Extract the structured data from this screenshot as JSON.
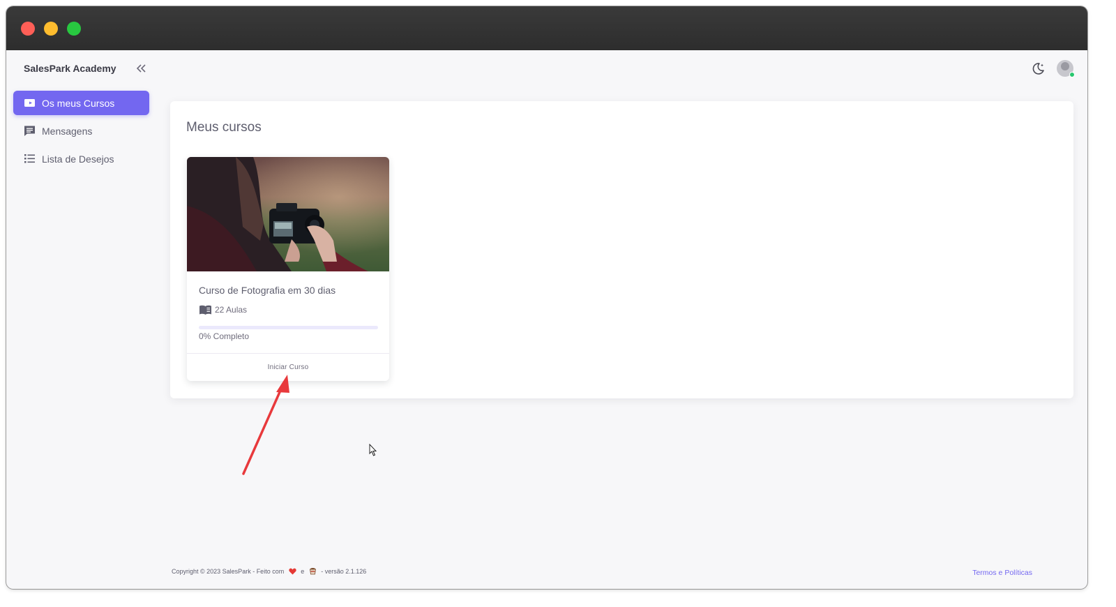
{
  "app": {
    "brand": "SalesPark Academy"
  },
  "sidebar": {
    "items": [
      {
        "label": "Os meus Cursos",
        "icon": "video-icon",
        "active": true
      },
      {
        "label": "Mensagens",
        "icon": "message-icon",
        "active": false
      },
      {
        "label": "Lista de Desejos",
        "icon": "list-icon",
        "active": false
      }
    ]
  },
  "header": {
    "theme_icon": "moon-icon",
    "avatar_status": "online"
  },
  "main": {
    "title": "Meus cursos",
    "courses": [
      {
        "title": "Curso de Fotografia em 30 dias",
        "lessons": "22 Aulas",
        "progress_percent": 0,
        "progress_text": "0% Completo",
        "action": "Iniciar Curso",
        "image": "photographer-with-camera"
      }
    ]
  },
  "footer": {
    "copyright_prefix": "Copyright © 2023 SalesPark - Feito com ",
    "copyright_and": " e ",
    "copyright_suffix": " - versão 2.1.126",
    "link": "Termos e Políticas"
  },
  "colors": {
    "accent": "#7367f0",
    "online": "#28c76f",
    "annotation_arrow": "#e8393c"
  }
}
